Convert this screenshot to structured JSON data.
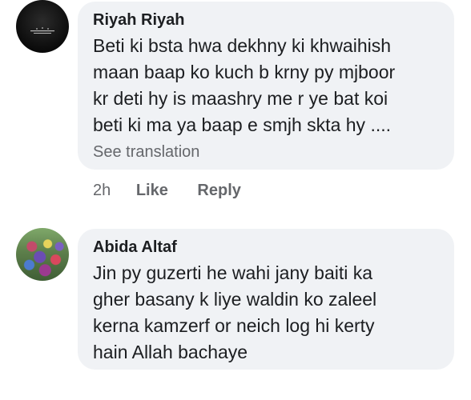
{
  "comments": [
    {
      "author": "Riyah Riyah",
      "lines": [
        "Beti ki bsta hwa dekhny ki khwaihish",
        "maan baap ko kuch b krny py mjboor",
        "kr deti hy is maashry me r ye bat koi",
        "beti ki ma ya baap e smjh skta hy ...."
      ],
      "see_translation": "See translation",
      "time": "2h",
      "like_label": "Like",
      "reply_label": "Reply"
    },
    {
      "author": "Abida Altaf",
      "lines": [
        "Jin py guzerti he wahi jany baiti ka",
        "gher basany k liye waldin ko zaleel",
        "kerna kamzerf or neich log hi kerty",
        "hain Allah bachaye"
      ]
    }
  ]
}
